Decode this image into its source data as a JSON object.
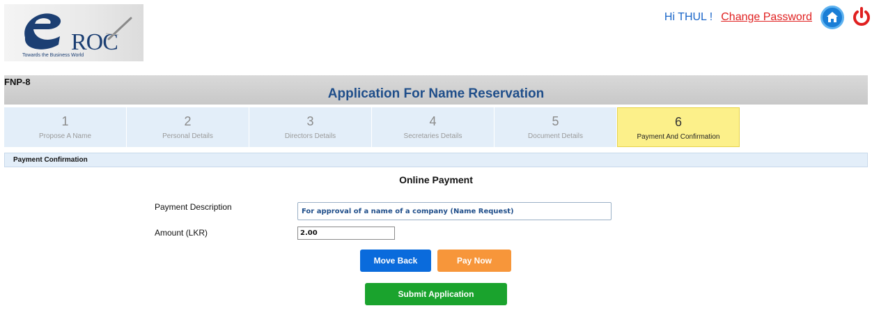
{
  "logo": {
    "brand": "ROC",
    "tagline": "Towards the Business World"
  },
  "header": {
    "greeting": "Hi THUL !",
    "change_password": "Change Password",
    "home_icon": "home-icon",
    "power_icon": "power-icon",
    "colors": {
      "link": "#e02020",
      "greeting": "#1a66c9"
    }
  },
  "form": {
    "code": "FNP-8",
    "title": "Application For Name Reservation"
  },
  "steps": [
    {
      "num": "1",
      "label": "Propose A Name"
    },
    {
      "num": "2",
      "label": "Personal Details"
    },
    {
      "num": "3",
      "label": "Directors Details"
    },
    {
      "num": "4",
      "label": "Secretaries Details"
    },
    {
      "num": "5",
      "label": "Document Details"
    },
    {
      "num": "6",
      "label": "Payment And Confirmation",
      "active": true
    }
  ],
  "section": {
    "title": "Payment Confirmation"
  },
  "payment": {
    "heading": "Online Payment",
    "description_label": "Payment Description",
    "description_value": "For approval of a name of a company (Name Request)",
    "amount_label": "Amount (LKR)",
    "amount_value": "2.00"
  },
  "buttons": {
    "move_back": "Move Back",
    "pay_now": "Pay Now",
    "submit": "Submit Application",
    "colors": {
      "move_back": "#0a6bdc",
      "pay_now": "#f7963a",
      "submit": "#1aa32d"
    }
  }
}
